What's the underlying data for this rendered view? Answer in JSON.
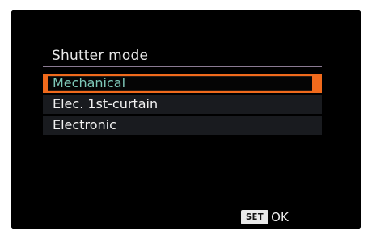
{
  "menu": {
    "title": "Shutter mode",
    "items": [
      {
        "label": "Mechanical",
        "selected": true
      },
      {
        "label": "Elec. 1st-curtain",
        "selected": false
      },
      {
        "label": "Electronic",
        "selected": false
      }
    ]
  },
  "footer": {
    "set_label": "SET",
    "ok_label": "OK"
  },
  "colors": {
    "highlight": "#f06a1c",
    "selected_text": "#7ec8b8",
    "row_background": "#191b1f"
  }
}
